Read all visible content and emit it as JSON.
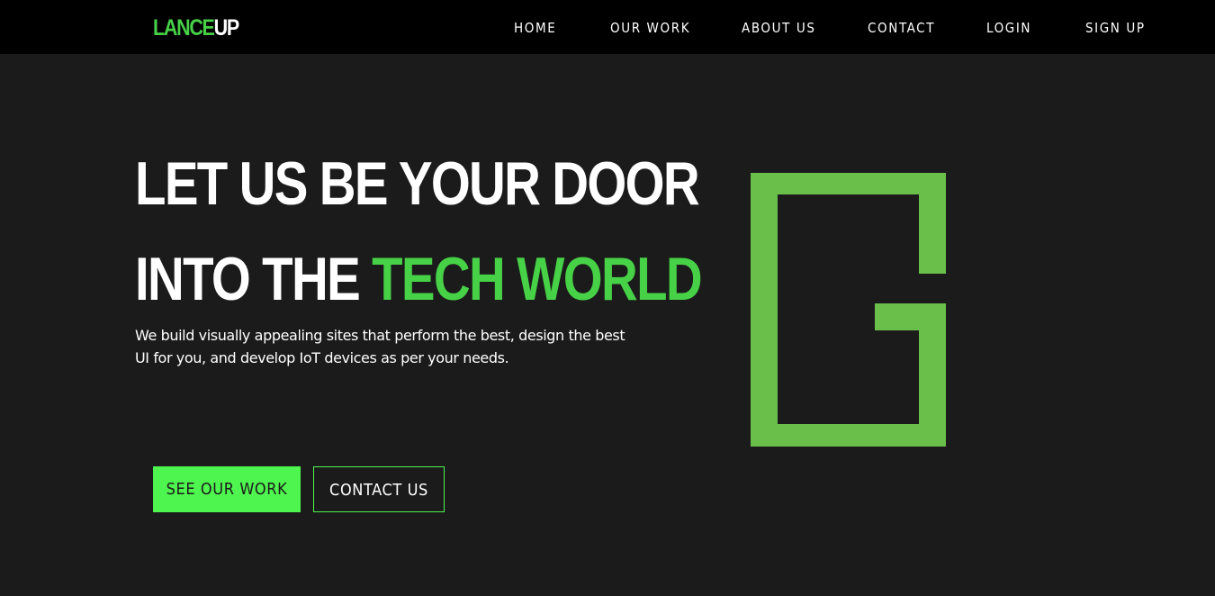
{
  "brand": {
    "name_part1": "LANCE",
    "name_part2": "UP",
    "accent_color": "#47d147",
    "button_color": "#4ff54f",
    "emblem_color": "#6abf4b"
  },
  "nav": {
    "items": [
      {
        "label": "HOME"
      },
      {
        "label": "OUR WORK"
      },
      {
        "label": "ABOUT US"
      },
      {
        "label": "CONTACT"
      },
      {
        "label": "LOGIN"
      },
      {
        "label": "SIGN UP"
      }
    ]
  },
  "hero": {
    "line1": "LET US BE YOUR DOOR",
    "line2_plain": "INTO THE ",
    "line2_accent": "TECH WORLD",
    "description": "We build visually appealing sites that perform the best, design the best UI for you, and develop IoT devices as per your needs.",
    "primary_button": "SEE OUR WORK",
    "secondary_button": "CONTACT US",
    "emblem_icon": "door-g-logo-icon"
  }
}
